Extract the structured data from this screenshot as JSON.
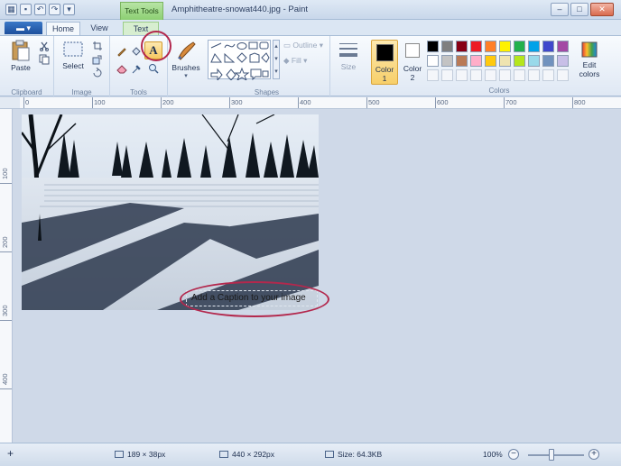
{
  "window": {
    "title": "Amphitheatre-snowat440.jpg - Paint",
    "context_tab_group": "Text Tools",
    "buttons": [
      "–",
      "□",
      "✕"
    ]
  },
  "ribbon_tabs": {
    "file": "▾",
    "home": "Home",
    "view": "View",
    "text": "Text"
  },
  "groups": {
    "clipboard": "Clipboard",
    "image": "Image",
    "tools": "Tools",
    "shapes": "Shapes",
    "colors": "Colors"
  },
  "buttons": {
    "paste": "Paste",
    "select": "Select",
    "brushes": "Brushes",
    "outline": "Outline",
    "fill": "Fill",
    "size": "Size",
    "color1": "Color\n1",
    "color1_line1": "Color",
    "color1_line2": "1",
    "color2_line1": "Color",
    "color2_line2": "2",
    "edit_colors_line1": "Edit",
    "edit_colors_line2": "colors",
    "text_tool": "A"
  },
  "palette_row1": [
    "#000000",
    "#7f7f7f",
    "#880015",
    "#ed1c24",
    "#ff7f27",
    "#fff200",
    "#22b14c",
    "#00a2e8",
    "#3f48cc",
    "#a349a4"
  ],
  "palette_row2": [
    "#ffffff",
    "#c3c3c3",
    "#b97a57",
    "#ffaec9",
    "#ffc90e",
    "#efe4b0",
    "#b5e61d",
    "#99d9ea",
    "#7092be",
    "#c8bfe7"
  ],
  "ruler": {
    "h_labels": [
      "0",
      "100",
      "200",
      "300",
      "400",
      "500",
      "600",
      "700",
      "800"
    ],
    "v_labels": [
      "100",
      "200",
      "300",
      "400"
    ]
  },
  "canvas": {
    "caption": "Add a Caption to your image"
  },
  "status": {
    "selection_size": "189 × 38px",
    "image_size": "440 × 292px",
    "file_size": "Size: 64.3KB",
    "zoom": "100%",
    "zoom_level": 1.0,
    "move_icon": "+"
  },
  "annotation_color": "#b3284d"
}
